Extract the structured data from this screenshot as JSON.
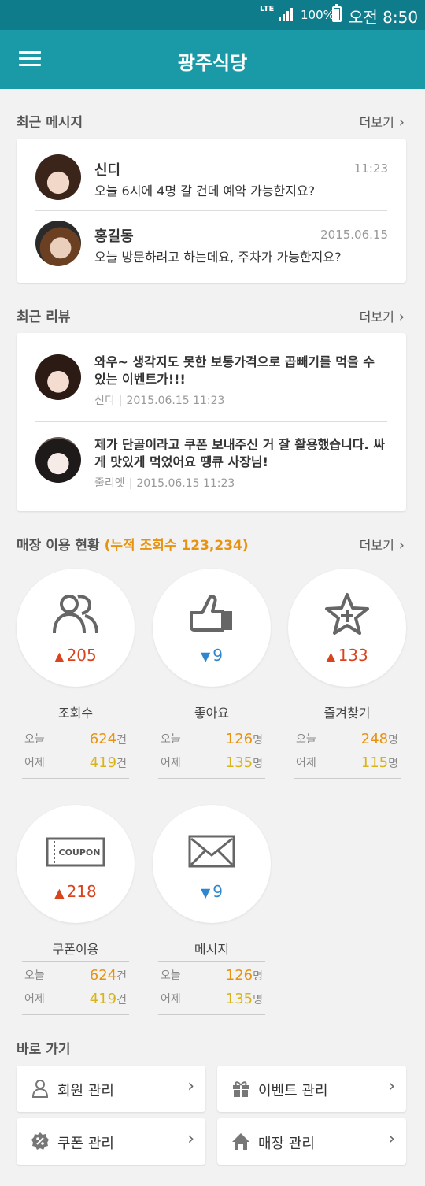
{
  "status": {
    "network": "LTE",
    "battery": "100%",
    "time": "오전 8:50"
  },
  "appbar": {
    "title": "광주식당"
  },
  "messages": {
    "title": "최근 메시지",
    "more": "더보기",
    "items": [
      {
        "name": "신디",
        "time": "11:23",
        "text": "오늘 6시에 4명 갈 건데 예약 가능한지요?"
      },
      {
        "name": "홍길동",
        "time": "2015.06.15",
        "text": "오늘 방문하려고 하는데요, 주차가 가능한지요?"
      }
    ]
  },
  "reviews": {
    "title": "최근 리뷰",
    "more": "더보기",
    "items": [
      {
        "text": "와우~ 생각지도 못한 보통가격으로 곱빼기를 먹을 수 있는 이벤트가!!!",
        "author": "신디",
        "date": "2015.06.15 11:23"
      },
      {
        "text": "제가 단골이라고 쿠폰 보내주신 거 잘 활용했습니다. 싸게 맛있게 먹었어요 땡큐 사장님!",
        "author": "줄리엣",
        "date": "2015.06.15 11:23"
      }
    ]
  },
  "usage": {
    "title": "매장 이용 현황",
    "accent": "(누적 조회수 123,234)",
    "more": "더보기",
    "stats": [
      {
        "label": "조회수",
        "delta": "205",
        "dir": "up",
        "today_label": "오늘",
        "today": "624",
        "yesterday_label": "어제",
        "yesterday": "419",
        "unit": "건"
      },
      {
        "label": "좋아요",
        "delta": "9",
        "dir": "down",
        "today_label": "오늘",
        "today": "126",
        "yesterday_label": "어제",
        "yesterday": "135",
        "unit": "명"
      },
      {
        "label": "즐겨찾기",
        "delta": "133",
        "dir": "up",
        "today_label": "오늘",
        "today": "248",
        "yesterday_label": "어제",
        "yesterday": "115",
        "unit": "명"
      },
      {
        "label": "쿠폰이용",
        "delta": "218",
        "dir": "up",
        "today_label": "오늘",
        "today": "624",
        "yesterday_label": "어제",
        "yesterday": "419",
        "unit": "건"
      },
      {
        "label": "메시지",
        "delta": "9",
        "dir": "down",
        "today_label": "오늘",
        "today": "126",
        "yesterday_label": "어제",
        "yesterday": "135",
        "unit": "명"
      }
    ],
    "coupon_icon_text": "COUPON"
  },
  "shortcuts": {
    "title": "바로 가기",
    "items": [
      {
        "label": "회원 관리",
        "icon": "person-icon"
      },
      {
        "label": "이벤트 관리",
        "icon": "gift-icon"
      },
      {
        "label": "쿠폰 관리",
        "icon": "coupon-badge-icon"
      },
      {
        "label": "매장 관리",
        "icon": "home-icon"
      }
    ]
  },
  "colors": {
    "statusbar": "#0f7c8c",
    "appbar": "#1a9aa7",
    "accent": "#e8930f",
    "up": "#d9441c",
    "down": "#2e86cf",
    "yesterday": "#d9b419"
  }
}
